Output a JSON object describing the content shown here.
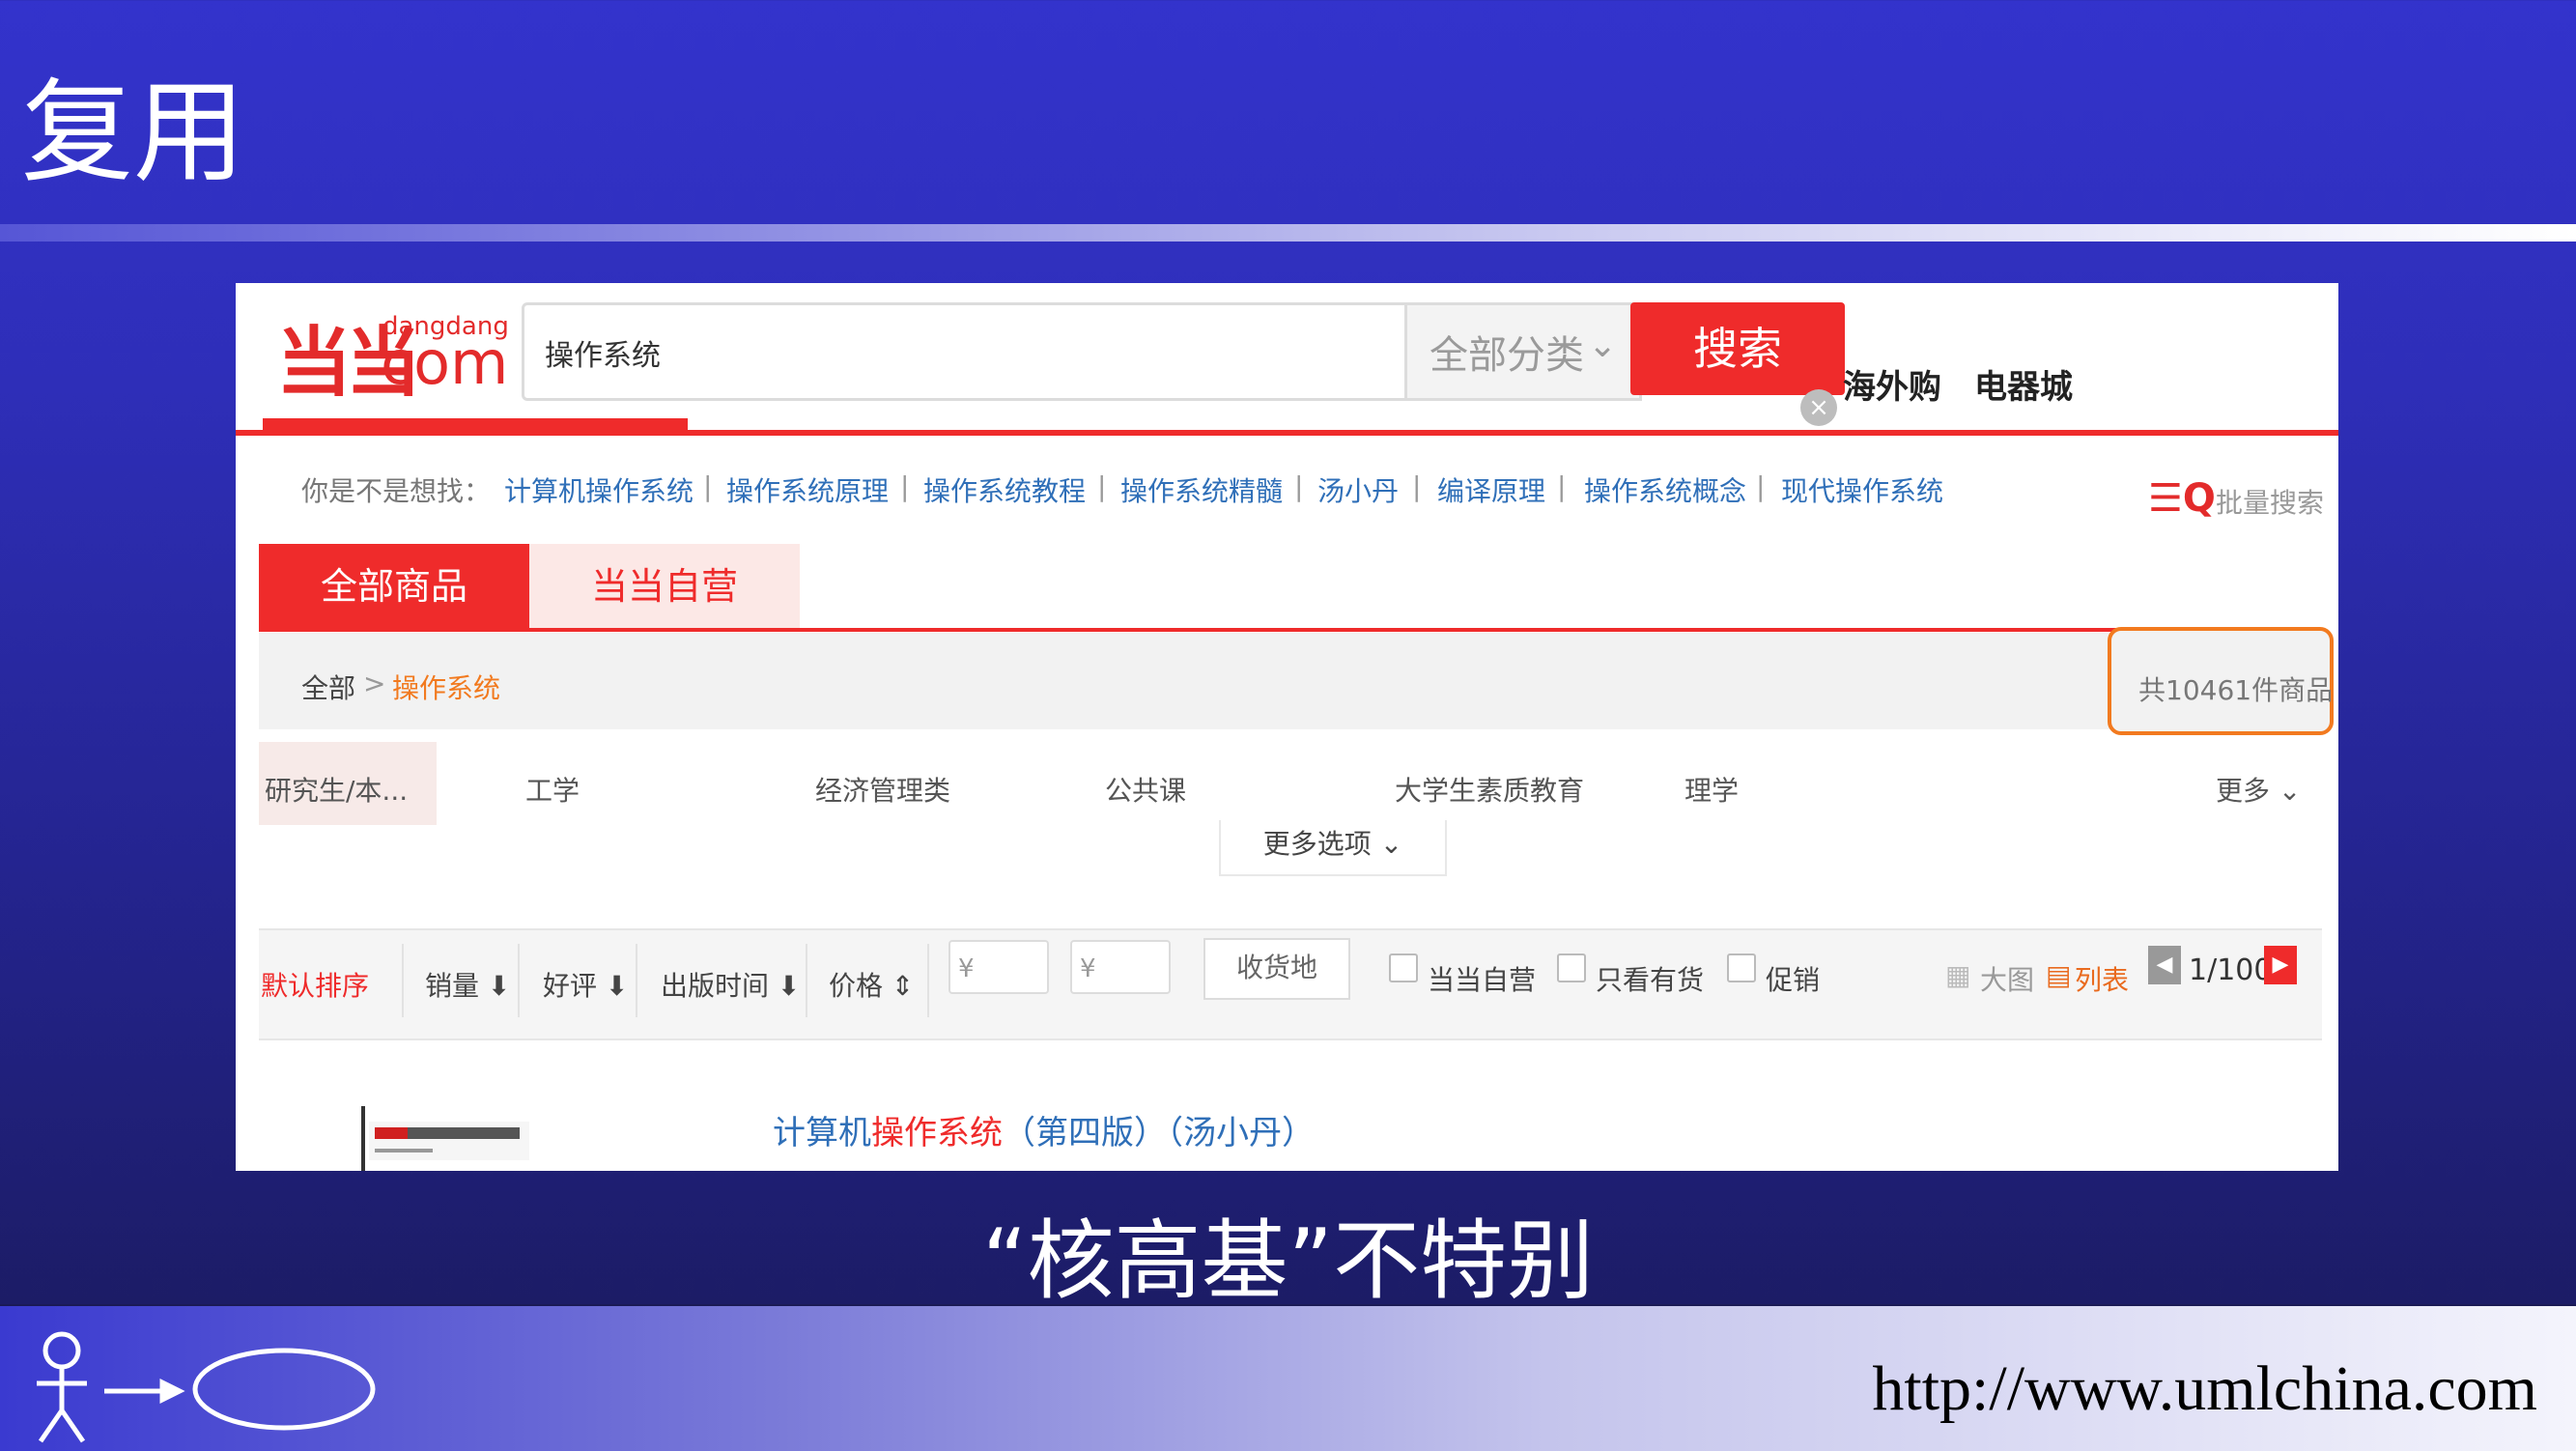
{
  "slide": {
    "title": "复用",
    "caption": "“核高基”不特别",
    "footer_url": "http://www.umlchina.com"
  },
  "screenshot": {
    "logo": {
      "mark": "当当",
      "small": "dangdang",
      "com": "com"
    },
    "search": {
      "value": "操作系统",
      "category": "全部分类",
      "button": "搜索"
    },
    "top_links": [
      "海外购",
      "电器城"
    ],
    "suggestions": {
      "lead": "你是不是想找：",
      "items": [
        "计算机操作系统",
        "操作系统原理",
        "操作系统教程",
        "操作系统精髓",
        "汤小丹",
        "编译原理",
        "操作系统概念",
        "现代操作系统"
      ],
      "separator": "|"
    },
    "batch_search": "批量搜索",
    "tabs": [
      "全部商品",
      "当当自营"
    ],
    "breadcrumb": {
      "root": "全部",
      "arrow": ">",
      "current": "操作系统"
    },
    "count": "共10461件商品",
    "facets": [
      "研究生/本...",
      "工学",
      "经济管理类",
      "公共课",
      "大学生素质教育",
      "理学"
    ],
    "more_facets": "更多",
    "more_options": "更多选项",
    "sort": {
      "default": "默认排序",
      "items": [
        "销量",
        "好评",
        "出版时间",
        "价格"
      ],
      "price_placeholder": "¥",
      "ship_to": "收货地",
      "filters": [
        "当当自营",
        "只看有货",
        "促销"
      ],
      "view_big": "大图",
      "view_list": "列表",
      "page": "1/100"
    },
    "product": {
      "title_prefix": "计算机",
      "title_highlight": "操作系统",
      "title_suffix": "（第四版）（汤小丹）"
    }
  },
  "colors": {
    "brand_red": "#ef2b2b",
    "link_blue": "#2f6fb8",
    "highlight_orange": "#f27a1f",
    "slide_blue": "#3333cc"
  },
  "icons": [
    "close-icon",
    "chevron-down-icon",
    "batch-search-icon",
    "grid-icon",
    "list-icon",
    "prev-page-icon",
    "next-page-icon",
    "stick-figure-icon",
    "arrow-icon",
    "oval-icon"
  ]
}
